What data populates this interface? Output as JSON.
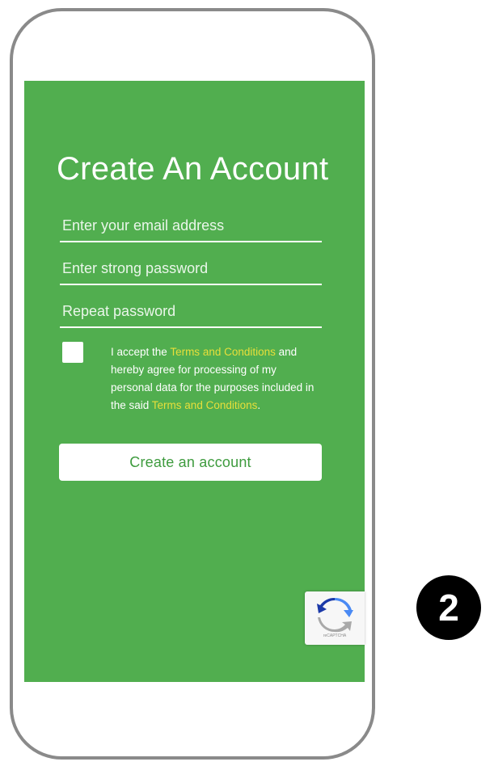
{
  "signup": {
    "title": "Create An Account",
    "email_placeholder": "Enter your email address",
    "password_placeholder": "Enter strong password",
    "repeat_placeholder": "Repeat password",
    "consent": {
      "text_1": "I accept the ",
      "link_1": "Terms and Conditions",
      "text_2": " and hereby agree for processing of my personal data for the purposes included in the said ",
      "link_2": "Terms and Conditions",
      "text_3": "."
    },
    "checkbox_checked": false,
    "button_label": "Create an account"
  },
  "recaptcha": {
    "label": "reCAPTCHA",
    "icon": "recaptcha-icon"
  },
  "step_badge": "2",
  "colors": {
    "screen_bg": "#51ae4f",
    "link": "#e8df3a",
    "button_text": "#3e9b3e",
    "phone_frame": "#8a8a8a",
    "badge_bg": "#000000"
  }
}
